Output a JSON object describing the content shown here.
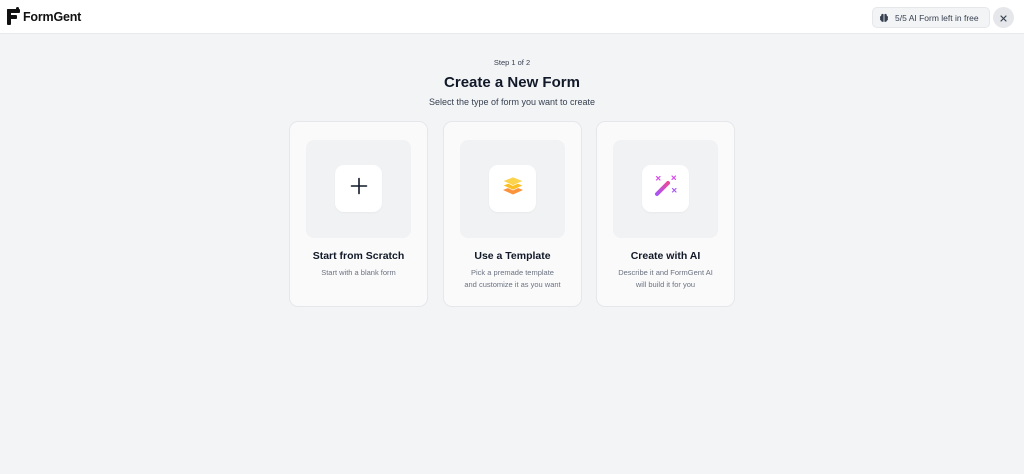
{
  "header": {
    "brand_name": "FormGent",
    "credits_text": "5/5 AI Form left in free",
    "credits_icon": "brain-icon",
    "close_icon": "close-icon"
  },
  "main": {
    "step": "Step 1 of 2",
    "title": "Create a New Form",
    "subtitle": "Select the type of form you want to create"
  },
  "options": [
    {
      "title": "Start from Scratch",
      "desc_lines": [
        "Start with a blank form"
      ],
      "icon": "plus-icon"
    },
    {
      "title": "Use a Template",
      "desc_lines": [
        "Pick a premade template",
        "and customize it as you want"
      ],
      "icon": "layers-icon"
    },
    {
      "title": "Create with AI",
      "desc_lines": [
        "Describe it and FormGent AI",
        "will build it for you"
      ],
      "icon": "magic-wand-icon"
    }
  ],
  "colors": {
    "background": "#f3f4f6",
    "template_accent": "#f59e0b",
    "ai_accent": "#d946ef"
  }
}
